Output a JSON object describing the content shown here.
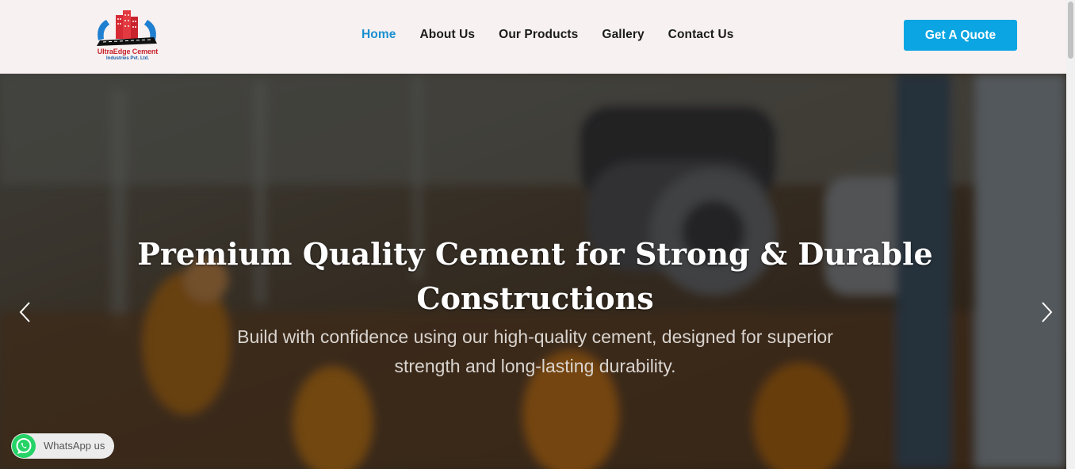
{
  "brand": {
    "name": "UltraEdge Cement",
    "subname": "Industries Pvt. Ltd.",
    "logo_icon": "building-logo-icon",
    "colors": {
      "red": "#c8232c",
      "blue": "#1d5fa8"
    }
  },
  "nav": {
    "items": [
      {
        "label": "Home",
        "active": true
      },
      {
        "label": "About Us",
        "active": false
      },
      {
        "label": "Our Products",
        "active": false
      },
      {
        "label": "Gallery",
        "active": false
      },
      {
        "label": "Contact Us",
        "active": false
      }
    ],
    "active_color": "#1a8fd0"
  },
  "cta": {
    "label": "Get A Quote",
    "color": "#0aa5e2"
  },
  "hero": {
    "title": "Premium Quality Cement for Strong & Durable Constructions",
    "subtitle": "Build with confidence using our high-quality cement, designed for superior strength and long-lasting durability.",
    "prev_icon": "chevron-left-icon",
    "next_icon": "chevron-right-icon"
  },
  "whatsapp": {
    "label": "WhatsApp us",
    "icon": "whatsapp-icon",
    "color": "#25d366"
  }
}
